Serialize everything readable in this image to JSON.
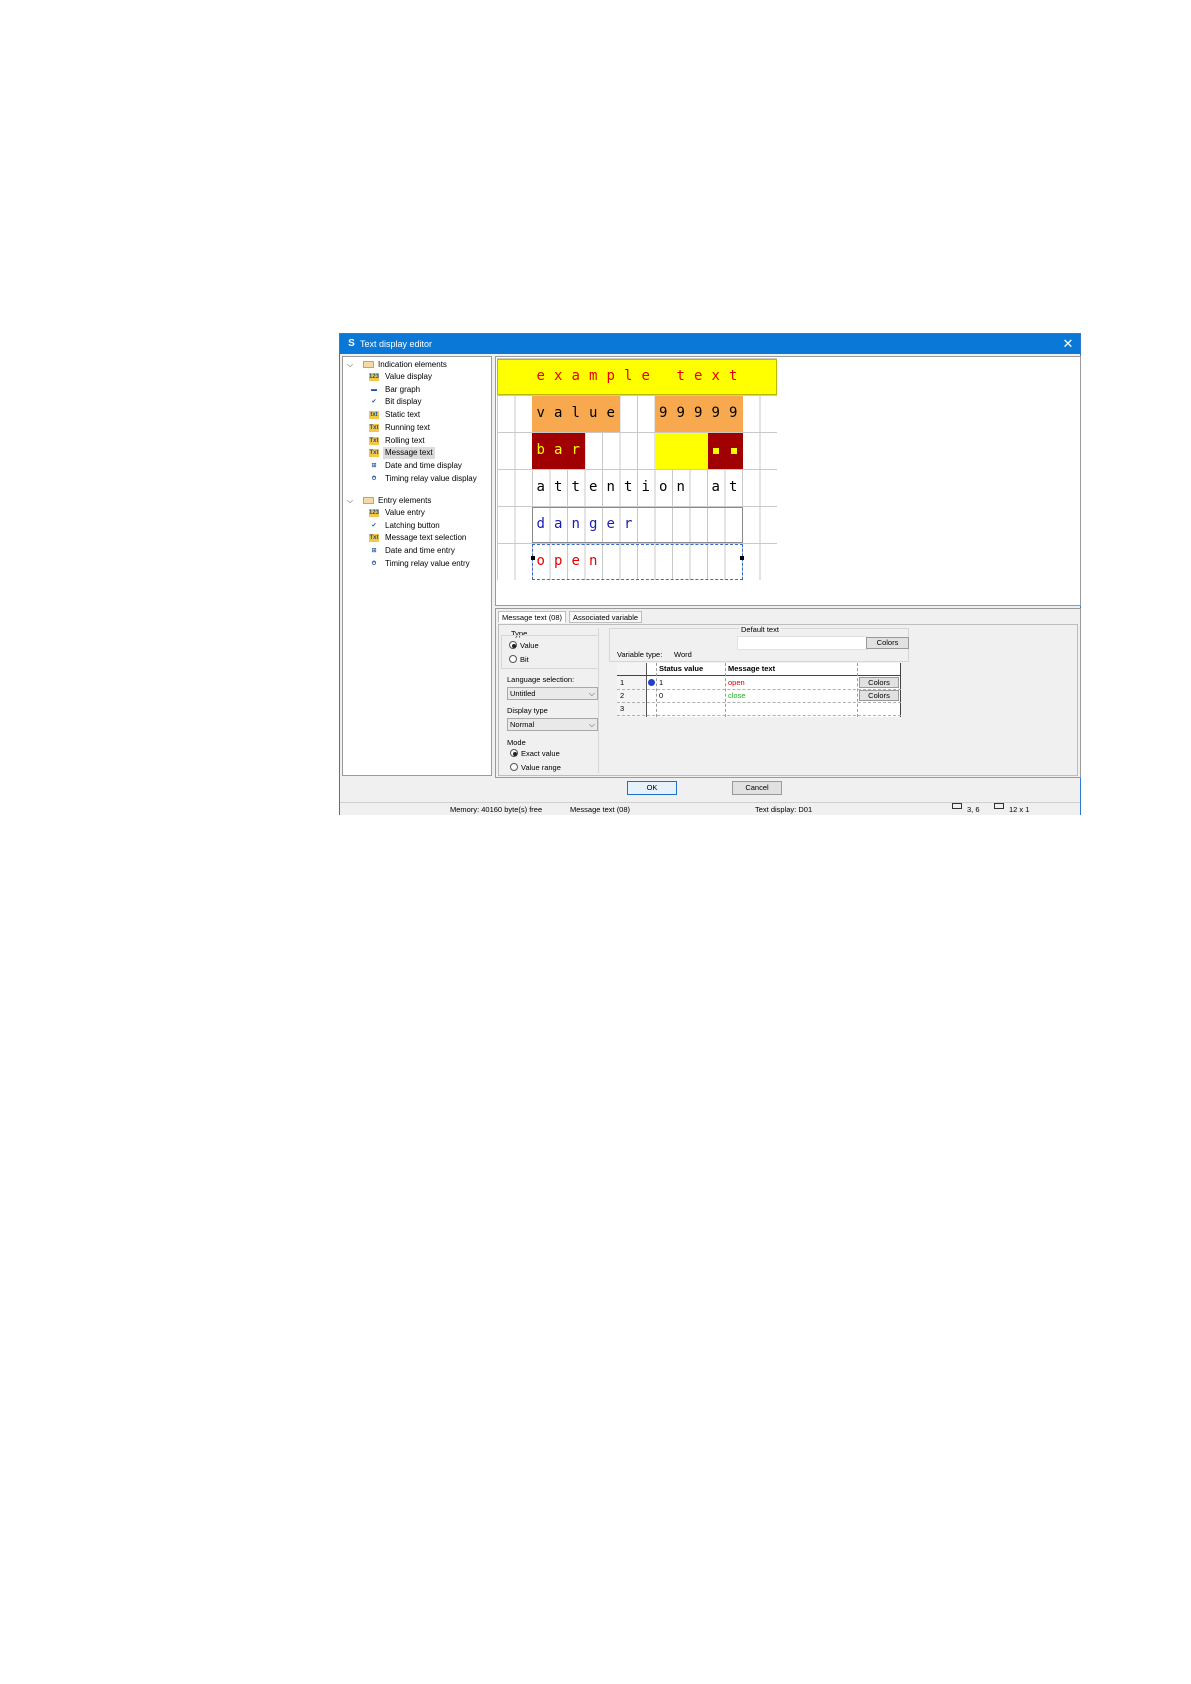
{
  "window": {
    "title": "Text display editor",
    "close_glyph": "✕",
    "app_icon": "S"
  },
  "tree": {
    "indication_group": "Indication elements",
    "indication_items": [
      {
        "label": "Value display",
        "icon": "value-display-icon",
        "glyph": "123"
      },
      {
        "label": "Bar graph",
        "icon": "bar-graph-icon",
        "glyph": "▬"
      },
      {
        "label": "Bit display",
        "icon": "bit-display-icon",
        "glyph": "✔"
      },
      {
        "label": "Static text",
        "icon": "static-text-icon",
        "glyph": "txt"
      },
      {
        "label": "Running text",
        "icon": "running-text-icon",
        "glyph": "Txt"
      },
      {
        "label": "Rolling text",
        "icon": "rolling-text-icon",
        "glyph": "Txt"
      },
      {
        "label": "Message text",
        "icon": "message-text-icon",
        "glyph": "Txt"
      },
      {
        "label": "Date and time display",
        "icon": "date-time-display-icon",
        "glyph": "⊞"
      },
      {
        "label": "Timing relay value display",
        "icon": "timing-relay-display-icon",
        "glyph": "⏱"
      }
    ],
    "entry_group": "Entry elements",
    "entry_items": [
      {
        "label": "Value entry",
        "icon": "value-entry-icon",
        "glyph": "123"
      },
      {
        "label": "Latching button",
        "icon": "latching-button-icon",
        "glyph": "✔"
      },
      {
        "label": "Message text selection",
        "icon": "message-text-selection-icon",
        "glyph": "Txt"
      },
      {
        "label": "Date and time entry",
        "icon": "date-time-entry-icon",
        "glyph": "⊞"
      },
      {
        "label": "Timing relay value entry",
        "icon": "timing-relay-entry-icon",
        "glyph": "⏱"
      }
    ]
  },
  "display": {
    "row1": "example text",
    "row2_left": "value",
    "row2_right": "99999",
    "row3_left": "bar",
    "row4": "attention at",
    "row5": "danger",
    "row6": "open",
    "colors": {
      "yellow": "#ffff00",
      "orange": "#f8a94f",
      "darkred": "#a00000",
      "red": "#e60000",
      "blue": "#1a1ab8"
    }
  },
  "properties": {
    "tabs": [
      "Message text (08)",
      "Associated variable"
    ],
    "type_label": "Type",
    "type_value": "Value",
    "type_bit": "Bit",
    "language_label": "Language selection:",
    "language_value": "Untitled",
    "display_type_label": "Display type",
    "display_type_value": "Normal",
    "mode_label": "Mode",
    "mode_exact": "Exact value",
    "mode_range": "Value range",
    "default_text_label": "Default text",
    "colors_button": "Colors",
    "variable_type_label": "Variable type:",
    "variable_type_value": "Word",
    "table": {
      "headers": [
        "Status value",
        "Message text"
      ],
      "rows": [
        {
          "n": "1",
          "status": "1",
          "text": "open",
          "color": "#d40000",
          "colors": "Colors"
        },
        {
          "n": "2",
          "status": "0",
          "text": "close",
          "color": "#20b020",
          "colors": "Colors"
        },
        {
          "n": "3",
          "status": "",
          "text": "",
          "color": "#000000",
          "colors": ""
        }
      ]
    }
  },
  "buttons": {
    "ok": "OK",
    "cancel": "Cancel"
  },
  "status": {
    "memory": "Memory: 40160 byte(s) free",
    "element": "Message text (08)",
    "display": "Text display: D01",
    "position": "3, 6",
    "size": "12 x 1"
  }
}
